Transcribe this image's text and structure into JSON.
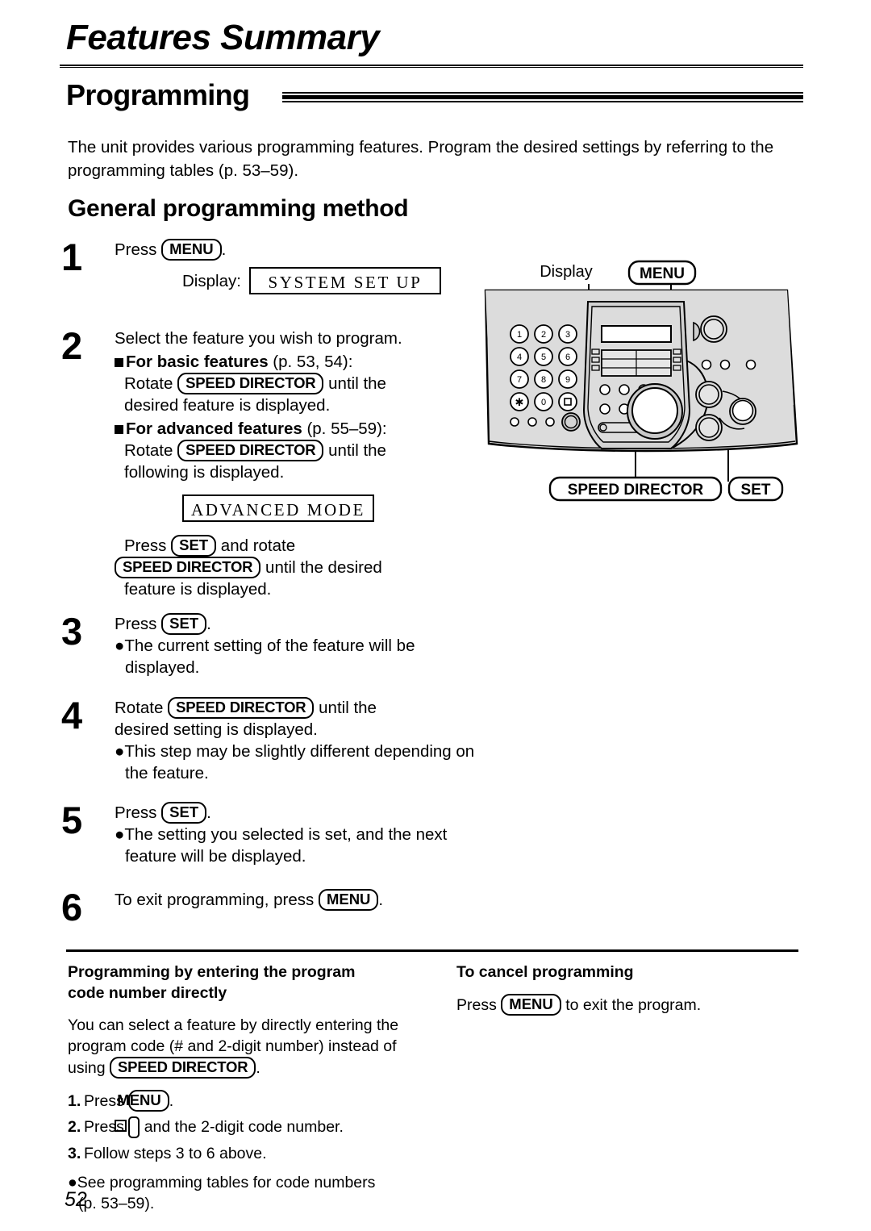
{
  "page": {
    "chapter_title": "Features Summary",
    "section_title": "Programming",
    "intro": "The unit provides various programming features. Program the desired settings by referring to the programming tables (p. 53–59).",
    "subsection_title": "General programming method",
    "page_number": "52"
  },
  "keys": {
    "menu": "MENU",
    "set": "SET",
    "speed_director": "SPEED DIRECTOR",
    "hash": "#"
  },
  "steps": [
    {
      "num": "1",
      "line1_pre": "Press",
      "line1_key": "MENU",
      "line1_post": ".",
      "display_label": "Display:",
      "display_value": "SYSTEM SET UP"
    },
    {
      "num": "2",
      "line1": "Select the feature you wish to program.",
      "basic_head": "For basic features",
      "basic_ref": "(p. 53, 54):",
      "basic_pre": "Rotate",
      "basic_key": "SPEED DIRECTOR",
      "basic_post": "until the",
      "basic_cont": "desired feature is displayed.",
      "adv_head": "For advanced features",
      "adv_ref": "(p. 55–59):",
      "adv_pre": "Rotate",
      "adv_key": "SPEED DIRECTOR",
      "adv_post": "until the",
      "adv_cont": "following is displayed.",
      "display_value": "ADVANCED MODE",
      "press_pre": "Press",
      "press_key": "SET",
      "press_post": "and rotate",
      "press_key2": "SPEED DIRECTOR",
      "press_post2": "until the desired",
      "press_cont": "feature is displayed."
    },
    {
      "num": "3",
      "line1_pre": "Press",
      "line1_key": "SET",
      "line1_post": ".",
      "bullet1": "The current setting of the feature will be displayed."
    },
    {
      "num": "4",
      "line1_pre": "Rotate",
      "line1_key": "SPEED DIRECTOR",
      "line1_post": "until the",
      "line2": "desired setting is displayed.",
      "bullet1": "This step may be slightly different depending on the feature."
    },
    {
      "num": "5",
      "line1_pre": "Press",
      "line1_key": "SET",
      "line1_post": ".",
      "bullet1": "The setting you selected is set, and the next feature will be displayed."
    },
    {
      "num": "6",
      "line1_pre": "To exit programming, press",
      "line1_key": "MENU",
      "line1_post": "."
    }
  ],
  "device": {
    "callout_display": "Display",
    "callout_menu": "MENU",
    "callout_speed_director": "SPEED DIRECTOR",
    "callout_set": "SET",
    "keypad": [
      "1",
      "2",
      "3",
      "4",
      "5",
      "6",
      "7",
      "8",
      "9",
      "∗",
      "0",
      "#"
    ],
    "body_color": "#dcdcdc",
    "outline_color": "#000000"
  },
  "bottom": {
    "left": {
      "heading_line1": "Programming by entering the program",
      "heading_line2": "code number directly",
      "para_pre": "You can select a feature by directly entering the program code (# and 2-digit number) instead of using",
      "para_key": "SPEED DIRECTOR",
      "para_post": ".",
      "items": [
        {
          "n": "1.",
          "pre": "Press",
          "key": "MENU",
          "post": "."
        },
        {
          "n": "2.",
          "pre": "Press",
          "key": "#",
          "post": "and the 2-digit code number."
        },
        {
          "n": "3.",
          "pre": "Follow steps 3 to 6 above.",
          "key": "",
          "post": ""
        }
      ],
      "note_line1": "See programming tables for code numbers",
      "note_line2": "(p. 53–59)."
    },
    "right": {
      "heading": "To cancel programming",
      "para_pre": "Press",
      "para_key": "MENU",
      "para_post": "to exit the program."
    }
  }
}
